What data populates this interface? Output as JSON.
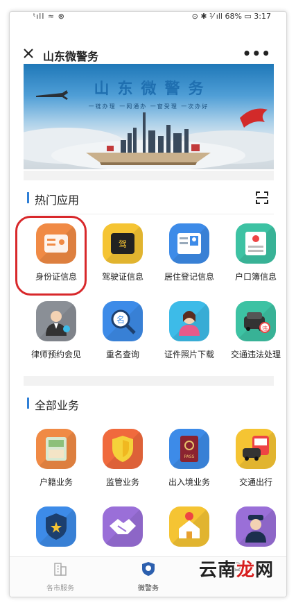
{
  "statusbar": {
    "left": "ᵗıll ≈ ⊗",
    "right": "⊙ ✱ ⅟ ıll 68% ▭ 3:17"
  },
  "navbar": {
    "title": "山东微警务",
    "more": "•••"
  },
  "banner": {
    "title": "山东微警务",
    "subtitle": "一链办理  一网通办  一窗受理  一次办好"
  },
  "hot_section": {
    "title": "热门应用",
    "items": [
      {
        "label": "身份证信息",
        "icon": "id-card-icon",
        "color": "#f08a45"
      },
      {
        "label": "驾驶证信息",
        "icon": "driver-license-icon",
        "color": "#f5c433"
      },
      {
        "label": "居住登记信息",
        "icon": "residence-card-icon",
        "color": "#3d8be8"
      },
      {
        "label": "户口簿信息",
        "icon": "household-book-icon",
        "color": "#3dc2a3"
      },
      {
        "label": "律师预约会见",
        "icon": "lawyer-icon",
        "color": "#8a8f96"
      },
      {
        "label": "重名查询",
        "icon": "name-search-icon",
        "color": "#3d8be8"
      },
      {
        "label": "证件照片下载",
        "icon": "photo-download-icon",
        "color": "#3dbbe8"
      },
      {
        "label": "交通违法处理",
        "icon": "traffic-violation-icon",
        "color": "#3dc2a3"
      }
    ]
  },
  "all_section": {
    "title": "全部业务",
    "items": [
      {
        "label": "户籍业务",
        "icon": "household-registration-icon",
        "color": "#f08a45"
      },
      {
        "label": "监管业务",
        "icon": "shield-supervision-icon",
        "color": "#f06a3d"
      },
      {
        "label": "出入境业务",
        "icon": "passport-icon",
        "color": "#3d8be8"
      },
      {
        "label": "交通出行",
        "icon": "traffic-icon",
        "color": "#f5c433"
      },
      {
        "label": "",
        "icon": "police-badge-icon",
        "color": "#3d8be8"
      },
      {
        "label": "",
        "icon": "handshake-icon",
        "color": "#9a6fd8"
      },
      {
        "label": "",
        "icon": "home-location-icon",
        "color": "#f5c433"
      },
      {
        "label": "",
        "icon": "police-officer-icon",
        "color": "#9a6fd8"
      }
    ]
  },
  "tabbar": {
    "tabs": [
      {
        "label": "各市服务",
        "icon": "city-building-icon",
        "active": false
      },
      {
        "label": "微警务",
        "icon": "police-shield-icon",
        "active": true
      },
      {
        "label": "",
        "icon": "person-icon",
        "active": false
      }
    ]
  },
  "watermark": {
    "part1": "云南",
    "part2": "龙",
    "part3": "网"
  }
}
